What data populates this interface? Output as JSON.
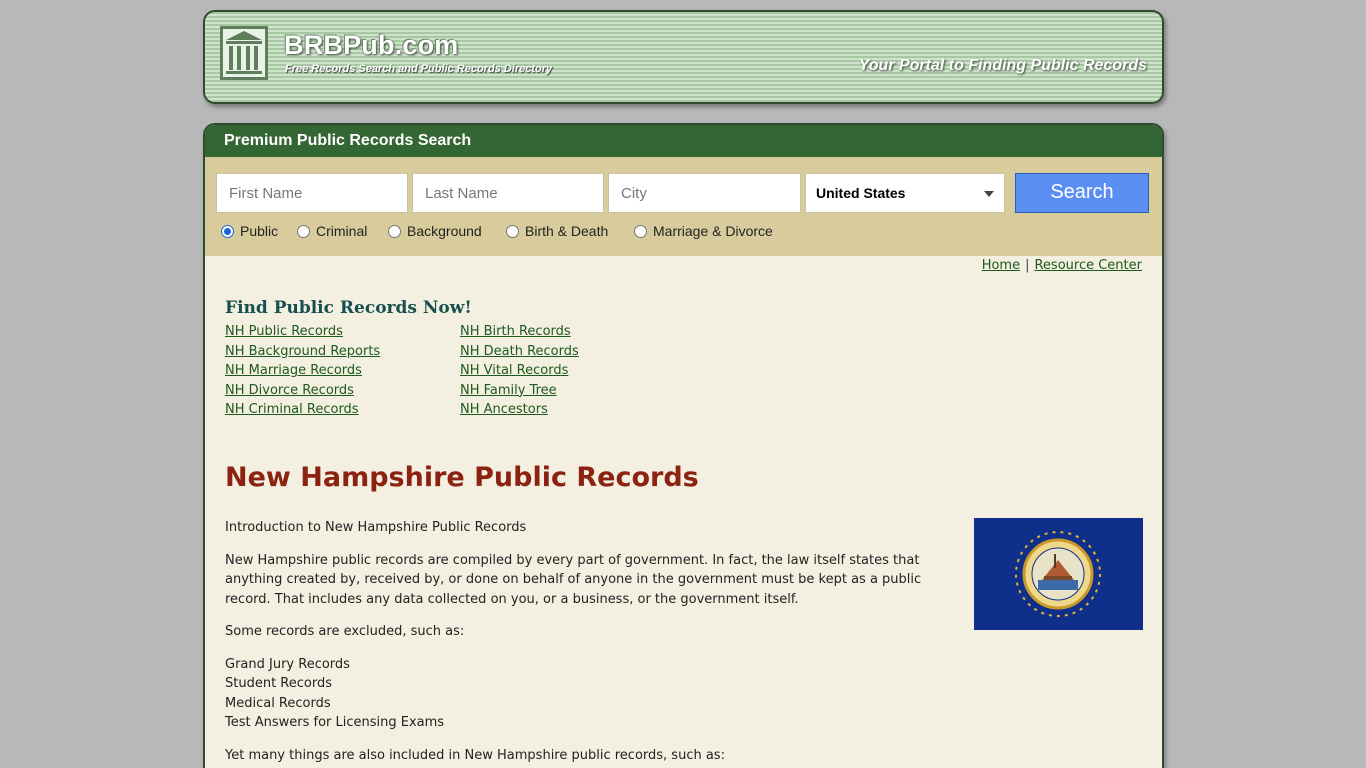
{
  "header": {
    "site_title": "BRBPub.com",
    "tagline": "Free Records Search and Public Records Directory",
    "portal_text": "Your Portal to Finding Public Records"
  },
  "search_panel": {
    "title": "Premium Public Records Search",
    "first_name_placeholder": "First Name",
    "last_name_placeholder": "Last Name",
    "city_placeholder": "City",
    "country_selected": "United States",
    "search_label": "Search",
    "radio_options": [
      "Public",
      "Criminal",
      "Background",
      "Birth & Death",
      "Marriage & Divorce"
    ],
    "radio_selected": "Public"
  },
  "nav": {
    "home": "Home",
    "separator": "|",
    "resource_center": "Resource Center"
  },
  "find": {
    "title": "Find Public Records Now!",
    "col1": [
      "NH Public Records",
      "NH Background Reports",
      "NH Marriage Records",
      "NH Divorce Records",
      "NH Criminal Records"
    ],
    "col2": [
      "NH Birth Records",
      "NH Death Records",
      "NH Vital Records",
      "NH Family Tree",
      "NH Ancestors"
    ]
  },
  "article": {
    "title": "New Hampshire Public Records",
    "intro": "Introduction to New Hampshire Public Records",
    "para1": "New Hampshire public records are compiled by every part of government. In fact, the law itself states that anything created by, received by, or done on behalf of anyone in the government must be kept as a public record. That includes any data collected on you, or a business, or the government itself.",
    "para2": "Some records are excluded, such as:",
    "excluded": [
      "Grand Jury Records",
      "Student Records",
      "Medical Records",
      "Test Answers for Licensing Exams"
    ],
    "para3": "Yet many things are also included in New Hampshire public records, such as:"
  },
  "colors": {
    "panel_head": "#336633",
    "search_bg": "#d8cc9c",
    "panel_bg": "#f3efe1",
    "title_red": "#8c2312",
    "link_green": "#1d5a1d",
    "flag_blue": "#0f2f8a",
    "button_blue": "#5b8ef2"
  }
}
